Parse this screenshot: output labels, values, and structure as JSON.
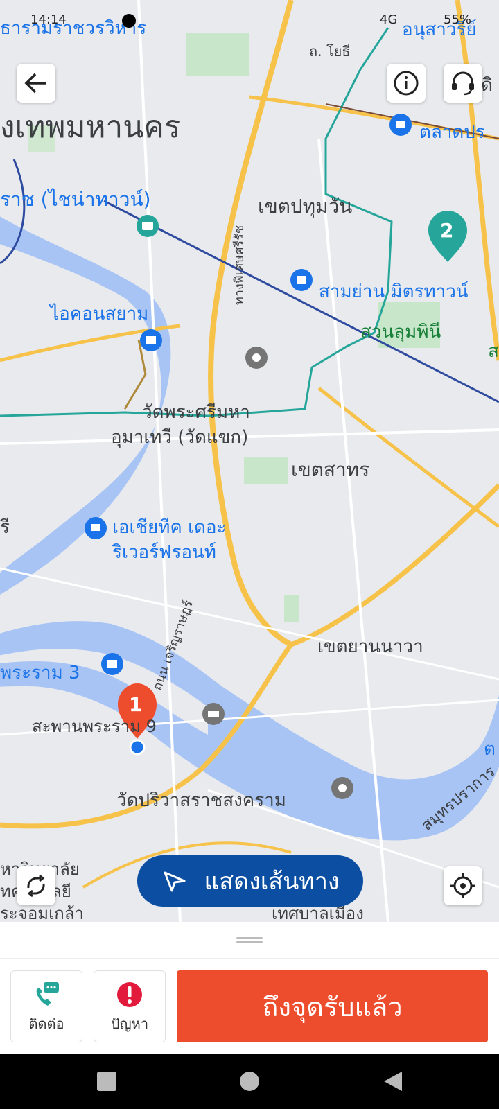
{
  "status_bar": {
    "time": "14:14",
    "network": "4G",
    "battery": "55%"
  },
  "map": {
    "labels": {
      "bangkok": "งเทพมหานคร",
      "palace_top": "ธารามราชวรวิหาร",
      "chinatown": "ราช (ไชน่าทาวน์)",
      "pathum_wan": "เขตปทุมวัน",
      "samyan": "สามย่าน มิตรทาวน์",
      "lumphini": "สวนลุมพินี",
      "talad": "ตลาดปร",
      "anusawari": "อนุสาวรีย์",
      "iconsiam": "ไอคอนสยาม",
      "wat_khaek_1": "วัดพระศรีมหา",
      "wat_khaek_2": "อุมาเทวี (วัดแขก)",
      "sathorn": "เขตสาทร",
      "asiatique_1": "เอเชียทีค เดอะ",
      "asiatique_2": "ริเวอร์ฟรอนท์",
      "yannawa": "เขตยานนาวา",
      "rama3": "พระราม 3",
      "rama9_bridge": "สะพานพระราม 9",
      "wat_pariwat": "วัดปริวาสราชสงคราม",
      "samut_prakan": "สมุทรปราการ",
      "road_phetchaburi": "ถ. โยธี",
      "road_witthayu": "ทางพิเศษศรีรัช",
      "road_charoen": "ถนน เจริญราษฎร์",
      "left_edge_ri": "รี",
      "univ_1": "หาวิทยาลัย",
      "univ_2": "ทคโนโลยี",
      "univ_3": "ระจอมเกล้า",
      "municipal": "เทศบาลเมือง",
      "di": "ดิ",
      "tho": "ต",
      "sa": "ส"
    },
    "markers": {
      "pickup": "1",
      "dropoff": "2"
    }
  },
  "buttons": {
    "show_route": "แสดงเส้นทาง",
    "contact": "ติดต่อ",
    "problem": "ปัญหา",
    "arrived_pickup": "ถึงจุดรับแล้ว"
  },
  "colors": {
    "accent": "#ee4d2d",
    "route_button": "#0b4ea2",
    "marker_pickup": "#ee4d2d",
    "marker_dropoff": "#26a69a",
    "river": "#a8c4f5",
    "road": "#f6c24a"
  }
}
